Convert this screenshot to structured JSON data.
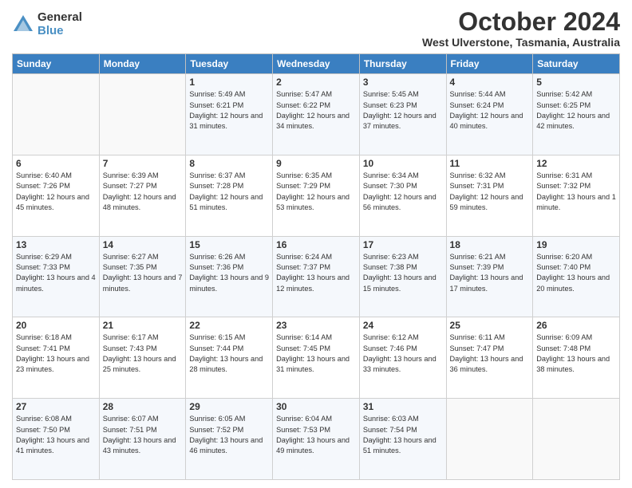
{
  "logo": {
    "general": "General",
    "blue": "Blue"
  },
  "header": {
    "title": "October 2024",
    "subtitle": "West Ulverstone, Tasmania, Australia"
  },
  "days": [
    "Sunday",
    "Monday",
    "Tuesday",
    "Wednesday",
    "Thursday",
    "Friday",
    "Saturday"
  ],
  "weeks": [
    [
      {
        "day": "",
        "info": ""
      },
      {
        "day": "",
        "info": ""
      },
      {
        "day": "1",
        "info": "Sunrise: 5:49 AM\nSunset: 6:21 PM\nDaylight: 12 hours and 31 minutes."
      },
      {
        "day": "2",
        "info": "Sunrise: 5:47 AM\nSunset: 6:22 PM\nDaylight: 12 hours and 34 minutes."
      },
      {
        "day": "3",
        "info": "Sunrise: 5:45 AM\nSunset: 6:23 PM\nDaylight: 12 hours and 37 minutes."
      },
      {
        "day": "4",
        "info": "Sunrise: 5:44 AM\nSunset: 6:24 PM\nDaylight: 12 hours and 40 minutes."
      },
      {
        "day": "5",
        "info": "Sunrise: 5:42 AM\nSunset: 6:25 PM\nDaylight: 12 hours and 42 minutes."
      }
    ],
    [
      {
        "day": "6",
        "info": "Sunrise: 6:40 AM\nSunset: 7:26 PM\nDaylight: 12 hours and 45 minutes."
      },
      {
        "day": "7",
        "info": "Sunrise: 6:39 AM\nSunset: 7:27 PM\nDaylight: 12 hours and 48 minutes."
      },
      {
        "day": "8",
        "info": "Sunrise: 6:37 AM\nSunset: 7:28 PM\nDaylight: 12 hours and 51 minutes."
      },
      {
        "day": "9",
        "info": "Sunrise: 6:35 AM\nSunset: 7:29 PM\nDaylight: 12 hours and 53 minutes."
      },
      {
        "day": "10",
        "info": "Sunrise: 6:34 AM\nSunset: 7:30 PM\nDaylight: 12 hours and 56 minutes."
      },
      {
        "day": "11",
        "info": "Sunrise: 6:32 AM\nSunset: 7:31 PM\nDaylight: 12 hours and 59 minutes."
      },
      {
        "day": "12",
        "info": "Sunrise: 6:31 AM\nSunset: 7:32 PM\nDaylight: 13 hours and 1 minute."
      }
    ],
    [
      {
        "day": "13",
        "info": "Sunrise: 6:29 AM\nSunset: 7:33 PM\nDaylight: 13 hours and 4 minutes."
      },
      {
        "day": "14",
        "info": "Sunrise: 6:27 AM\nSunset: 7:35 PM\nDaylight: 13 hours and 7 minutes."
      },
      {
        "day": "15",
        "info": "Sunrise: 6:26 AM\nSunset: 7:36 PM\nDaylight: 13 hours and 9 minutes."
      },
      {
        "day": "16",
        "info": "Sunrise: 6:24 AM\nSunset: 7:37 PM\nDaylight: 13 hours and 12 minutes."
      },
      {
        "day": "17",
        "info": "Sunrise: 6:23 AM\nSunset: 7:38 PM\nDaylight: 13 hours and 15 minutes."
      },
      {
        "day": "18",
        "info": "Sunrise: 6:21 AM\nSunset: 7:39 PM\nDaylight: 13 hours and 17 minutes."
      },
      {
        "day": "19",
        "info": "Sunrise: 6:20 AM\nSunset: 7:40 PM\nDaylight: 13 hours and 20 minutes."
      }
    ],
    [
      {
        "day": "20",
        "info": "Sunrise: 6:18 AM\nSunset: 7:41 PM\nDaylight: 13 hours and 23 minutes."
      },
      {
        "day": "21",
        "info": "Sunrise: 6:17 AM\nSunset: 7:43 PM\nDaylight: 13 hours and 25 minutes."
      },
      {
        "day": "22",
        "info": "Sunrise: 6:15 AM\nSunset: 7:44 PM\nDaylight: 13 hours and 28 minutes."
      },
      {
        "day": "23",
        "info": "Sunrise: 6:14 AM\nSunset: 7:45 PM\nDaylight: 13 hours and 31 minutes."
      },
      {
        "day": "24",
        "info": "Sunrise: 6:12 AM\nSunset: 7:46 PM\nDaylight: 13 hours and 33 minutes."
      },
      {
        "day": "25",
        "info": "Sunrise: 6:11 AM\nSunset: 7:47 PM\nDaylight: 13 hours and 36 minutes."
      },
      {
        "day": "26",
        "info": "Sunrise: 6:09 AM\nSunset: 7:48 PM\nDaylight: 13 hours and 38 minutes."
      }
    ],
    [
      {
        "day": "27",
        "info": "Sunrise: 6:08 AM\nSunset: 7:50 PM\nDaylight: 13 hours and 41 minutes."
      },
      {
        "day": "28",
        "info": "Sunrise: 6:07 AM\nSunset: 7:51 PM\nDaylight: 13 hours and 43 minutes."
      },
      {
        "day": "29",
        "info": "Sunrise: 6:05 AM\nSunset: 7:52 PM\nDaylight: 13 hours and 46 minutes."
      },
      {
        "day": "30",
        "info": "Sunrise: 6:04 AM\nSunset: 7:53 PM\nDaylight: 13 hours and 49 minutes."
      },
      {
        "day": "31",
        "info": "Sunrise: 6:03 AM\nSunset: 7:54 PM\nDaylight: 13 hours and 51 minutes."
      },
      {
        "day": "",
        "info": ""
      },
      {
        "day": "",
        "info": ""
      }
    ]
  ]
}
